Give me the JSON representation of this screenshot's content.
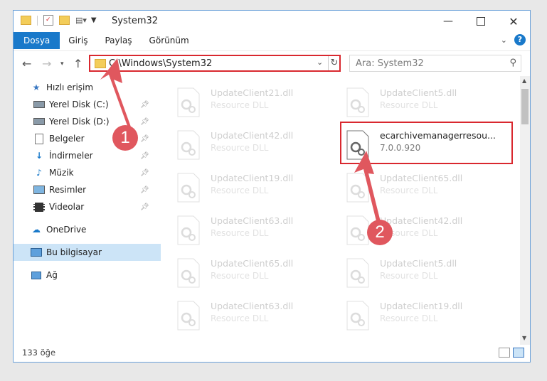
{
  "window": {
    "title": "System32"
  },
  "ribbon": {
    "tabs": [
      "Dosya",
      "Giriş",
      "Paylaş",
      "Görünüm"
    ]
  },
  "address": {
    "path": "C:\\Windows\\System32"
  },
  "search": {
    "placeholder": "Ara: System32"
  },
  "sidebar": {
    "items": [
      {
        "label": "Hızlı erişim",
        "icon": "star-icon"
      },
      {
        "label": "Yerel Disk (C:)",
        "icon": "drive-icon"
      },
      {
        "label": "Yerel Disk (D:)",
        "icon": "drive-icon"
      },
      {
        "label": "Belgeler",
        "icon": "document-icon"
      },
      {
        "label": "İndirmeler",
        "icon": "download-icon"
      },
      {
        "label": "Müzik",
        "icon": "music-icon"
      },
      {
        "label": "Resimler",
        "icon": "pictures-icon"
      },
      {
        "label": "Videolar",
        "icon": "video-icon"
      },
      {
        "label": "OneDrive",
        "icon": "cloud-icon"
      },
      {
        "label": "Bu bilgisayar",
        "icon": "computer-icon"
      },
      {
        "label": "Ağ",
        "icon": "network-icon"
      }
    ]
  },
  "files": {
    "left": [
      {
        "name": "UpdateClient21.dll",
        "desc": "Resource DLL"
      },
      {
        "name": "UpdateClient42.dll",
        "desc": "Resource DLL"
      },
      {
        "name": "UpdateClient19.dll",
        "desc": "Resource DLL"
      },
      {
        "name": "UpdateClient63.dll",
        "desc": "Resource DLL"
      },
      {
        "name": "UpdateClient65.dll",
        "desc": "Resource DLL"
      },
      {
        "name": "UpdateClient63.dll",
        "desc": "Resource DLL"
      }
    ],
    "right": [
      {
        "name": "UpdateClient5.dll",
        "desc": "Resource DLL"
      },
      {
        "name": "ecarchivemanagerresou...",
        "desc": "7.0.0.920"
      },
      {
        "name": "UpdateClient65.dll",
        "desc": "Resource DLL"
      },
      {
        "name": "UpdateClient42.dll",
        "desc": "Resource DLL"
      },
      {
        "name": "UpdateClient5.dll",
        "desc": "Resource DLL"
      },
      {
        "name": "UpdateClient19.dll",
        "desc": "Resource DLL"
      }
    ]
  },
  "status": {
    "count": "133 öğe"
  },
  "annotations": {
    "badge1": "1",
    "badge2": "2"
  },
  "colors": {
    "accent": "#1979ca",
    "highlight": "#d9282f",
    "badge": "#e0575e"
  }
}
